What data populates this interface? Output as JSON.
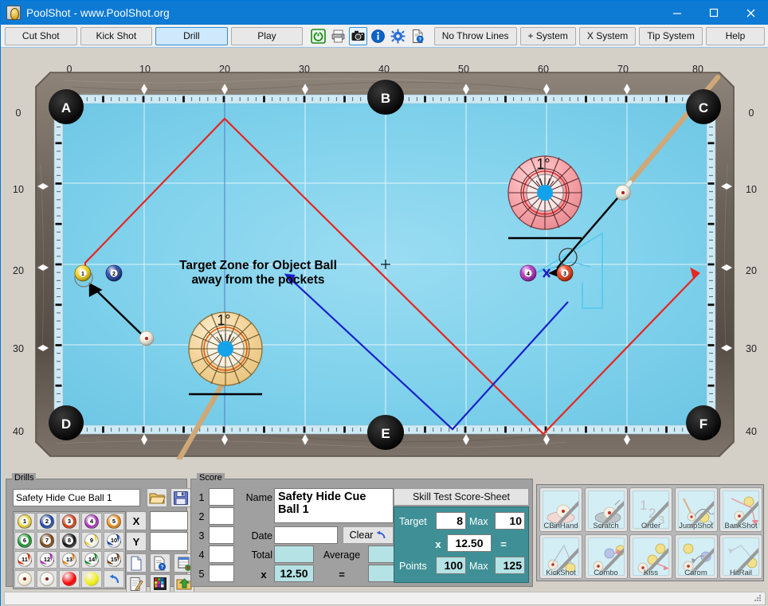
{
  "window": {
    "title": "PoolShot - www.PoolShot.org",
    "icon": "app-poolshot-icon",
    "minimize": "–",
    "maximize": "□",
    "close": "✕"
  },
  "toolbar": {
    "modes": [
      {
        "label": "Cut Shot",
        "selected": false
      },
      {
        "label": "Kick Shot",
        "selected": false
      },
      {
        "label": "Drill",
        "selected": true
      },
      {
        "label": "Play",
        "selected": false
      }
    ],
    "icons": [
      {
        "name": "power-icon",
        "framed": false
      },
      {
        "name": "printer-icon",
        "framed": false
      },
      {
        "name": "camera-icon",
        "framed": true
      },
      {
        "name": "info-icon",
        "framed": false
      },
      {
        "name": "settings-gear-icon",
        "framed": false
      },
      {
        "name": "help-document-icon",
        "framed": false
      }
    ],
    "systems": [
      {
        "label": "No Throw Lines"
      },
      {
        "label": "+ System"
      },
      {
        "label": "X System"
      },
      {
        "label": "Tip System"
      }
    ],
    "help_label": "Help"
  },
  "table": {
    "top_ruler": [
      "0",
      "10",
      "20",
      "30",
      "40",
      "50",
      "60",
      "70",
      "80"
    ],
    "left_ruler": [
      "0",
      "10",
      "20",
      "30",
      "40"
    ],
    "right_ruler": [
      "0",
      "10",
      "20",
      "30",
      "40"
    ],
    "pockets": [
      "A",
      "B",
      "C",
      "D",
      "E",
      "F"
    ],
    "annotation_line1": "Target Zone for Object Ball",
    "annotation_line2": "away from the pockets",
    "protractor_label": "1°",
    "colors": {
      "cloth": "#7fd3ec",
      "rail": "#6b6258",
      "red_line": "#e8251f",
      "blue_line": "#1822c8",
      "aim_line": "#000000",
      "zone_outline": "#49c4ee"
    },
    "balls": [
      {
        "name": "ball-1",
        "number": "1",
        "color": "#f2d116"
      },
      {
        "name": "ball-2",
        "number": "2",
        "color": "#1d3f9e"
      },
      {
        "name": "ball-4",
        "number": "4",
        "color": "#b02ec0"
      },
      {
        "name": "ball-3",
        "number": "3",
        "color": "#e23a10"
      },
      {
        "name": "cue-ball-left",
        "number": "",
        "color": "#f6f2e4"
      },
      {
        "name": "cue-ball-right",
        "number": "",
        "color": "#f6f2e4"
      }
    ]
  },
  "drills": {
    "caption": "Drills",
    "name_value": "Safety Hide Cue Ball 1",
    "open_icon": "open-folder-icon",
    "save_icon": "floppy-save-icon",
    "x_label": "X",
    "y_label": "Y",
    "x_value": "",
    "y_value": "",
    "palette": [
      {
        "n": "1",
        "c": "#f0d32a",
        "type": "solid"
      },
      {
        "n": "2",
        "c": "#1a46b0",
        "type": "solid"
      },
      {
        "n": "3",
        "c": "#e03a0e",
        "type": "solid"
      },
      {
        "n": "4",
        "c": "#b02ec0",
        "type": "solid"
      },
      {
        "n": "5",
        "c": "#f08a0c",
        "type": "solid"
      },
      {
        "n": "6",
        "c": "#16962d",
        "type": "solid"
      },
      {
        "n": "7",
        "c": "#7a4510",
        "type": "solid"
      },
      {
        "n": "8",
        "c": "#111111",
        "type": "solid"
      },
      {
        "n": "9",
        "c": "#f0d32a",
        "type": "stripe"
      },
      {
        "n": "10",
        "c": "#1a46b0",
        "type": "stripe"
      },
      {
        "n": "11",
        "c": "#e03a0e",
        "type": "stripe"
      },
      {
        "n": "12",
        "c": "#b02ec0",
        "type": "stripe"
      },
      {
        "n": "13",
        "c": "#f08a0c",
        "type": "stripe"
      },
      {
        "n": "14",
        "c": "#16962d",
        "type": "stripe"
      },
      {
        "n": "15",
        "c": "#7a4510",
        "type": "stripe"
      },
      {
        "n": "",
        "c": "#f6f0d8",
        "type": "cueball"
      },
      {
        "n": "",
        "c": "#f2f2f2",
        "type": "cueball2"
      },
      {
        "n": "",
        "c": "#f40000",
        "type": "plain"
      },
      {
        "n": "",
        "c": "#f0ee10",
        "type": "plain"
      },
      {
        "n": "",
        "c": "#2a6fd8",
        "type": "undo"
      }
    ],
    "tools": [
      {
        "name": "new-page-icon"
      },
      {
        "name": "help-document-icon"
      },
      {
        "name": "table-list-icon"
      },
      {
        "name": "edit-notes-icon"
      },
      {
        "name": "color-palette-icon"
      },
      {
        "name": "export-folder-icon"
      }
    ]
  },
  "score": {
    "caption": "Score",
    "rows": [
      "1",
      "2",
      "3",
      "4",
      "5"
    ],
    "row_values": [
      "",
      "",
      "",
      "",
      ""
    ],
    "name_label": "Name",
    "name_value": "Safety Hide Cue Ball 1",
    "date_label": "Date",
    "date_value": "",
    "clear_label": "Clear",
    "clear_icon": "undo-arrow-icon",
    "total_label": "Total",
    "total_value": "",
    "average_label": "Average",
    "average_value": "",
    "multiply_label": "x",
    "multiplier_value": "12.50",
    "equals_label": "=",
    "result_value": ""
  },
  "skill_test": {
    "title": "Skill Test Score-Sheet",
    "target_label": "Target",
    "target_value": "8",
    "target_max_label": "Max",
    "target_max_value": "10",
    "multiply_label": "x",
    "multiplier_value": "12.50",
    "equals_label": "=",
    "points_label": "Points",
    "points_value": "100",
    "points_max_label": "Max",
    "points_max_value": "125",
    "panel_color": "#3f9096"
  },
  "skill_buttons": [
    {
      "label": "CBinHand",
      "icon": "hand-ball-icon"
    },
    {
      "label": "Scratch",
      "icon": "scratch-pocket-icon"
    },
    {
      "label": "Order",
      "icon": "number-order-icon"
    },
    {
      "label": "JumpShot",
      "icon": "jump-shot-icon"
    },
    {
      "label": "BankShot",
      "icon": "bank-shot-icon"
    },
    {
      "label": "KickShot",
      "icon": "kick-shot-icon"
    },
    {
      "label": "Combo",
      "icon": "combo-shot-icon"
    },
    {
      "label": "Kiss",
      "icon": "kiss-shot-icon"
    },
    {
      "label": "Carom",
      "icon": "carom-shot-icon"
    },
    {
      "label": "HitRail",
      "icon": "hit-rail-icon"
    }
  ]
}
